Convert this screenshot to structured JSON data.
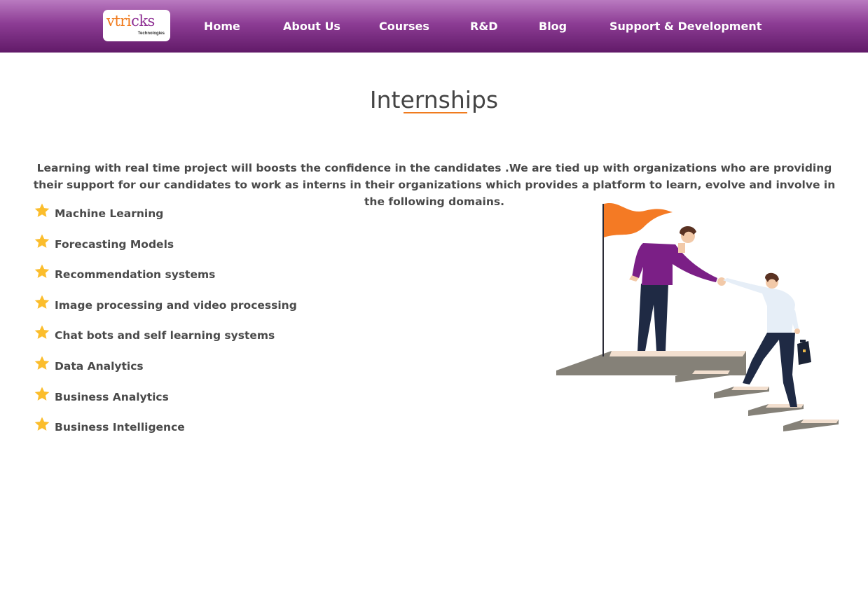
{
  "header": {
    "logo": {
      "word_part1": "vtri",
      "word_part2": "cks",
      "sub": "Technologies"
    },
    "nav": [
      {
        "label": "Home"
      },
      {
        "label": "About Us"
      },
      {
        "label": "Courses"
      },
      {
        "label": "R&D"
      },
      {
        "label": "Blog"
      },
      {
        "label": "Support & Development"
      }
    ]
  },
  "main": {
    "title": "Internships",
    "intro": "Learning with real time project will boosts the confidence in the candidates .We are tied up with organizations who are providing their support for our candidates to work as interns in their organizations which provides a platform to learn, evolve and involve in the following domains.",
    "domains": [
      {
        "label": "Machine Learning",
        "icon": "star-icon"
      },
      {
        "label": "Forecasting Models",
        "icon": "star-icon"
      },
      {
        "label": "Recommendation systems",
        "icon": "star-icon"
      },
      {
        "label": "Image processing and video processing",
        "icon": "star-icon"
      },
      {
        "label": "Chat bots and self learning systems",
        "icon": "star-icon"
      },
      {
        "label": "Data Analytics",
        "icon": "star-icon"
      },
      {
        "label": "Business Analytics",
        "icon": "star-icon"
      },
      {
        "label": "Business Intelligence",
        "icon": "star-icon"
      }
    ]
  },
  "colors": {
    "nav_gradient_top": "#b97ac0",
    "nav_gradient_bottom": "#611a68",
    "accent_orange": "#f07b1e",
    "brand_purple": "#8e2f93",
    "star": "#fbbd2c",
    "text": "#4a4a4a"
  }
}
